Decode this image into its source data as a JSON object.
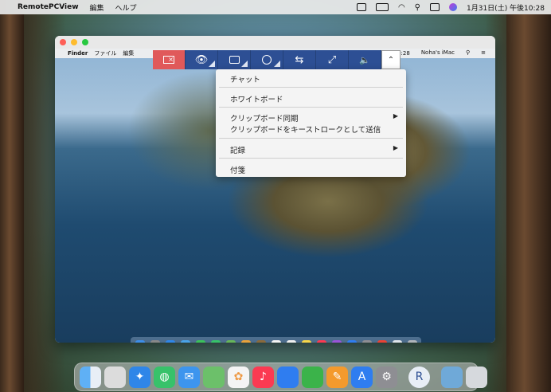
{
  "menubar": {
    "app_name": "RemotePCView",
    "items": [
      "編集",
      "ヘルプ"
    ],
    "datetime": "1月31日(土) 午後10:28"
  },
  "remote": {
    "menubar": {
      "finder": "Finder",
      "file": "ファイル",
      "edit": "編集",
      "time": "後10:28",
      "computer": "Noha's iMac"
    }
  },
  "toolbar": {
    "buttons": [
      {
        "icon": "screen-close-icon"
      },
      {
        "icon": "eye-icon"
      },
      {
        "icon": "toolbox-icon"
      },
      {
        "icon": "settings-dial-icon"
      },
      {
        "icon": "transfer-arrows-icon"
      },
      {
        "icon": "fullscreen-icon"
      },
      {
        "icon": "speaker-icon"
      },
      {
        "icon": "chevron-up-icon"
      }
    ]
  },
  "dropdown": {
    "chat": "チャット",
    "whiteboard": "ホワイトボード",
    "clipboard_sync": "クリップボード同期",
    "clipboard_keystroke": "クリップボードをキーストロークとして送信",
    "record": "記録",
    "sticky": "付箋"
  },
  "colors": {
    "toolbar_blue": "#2d4f94",
    "toolbar_red": "#e0595a"
  }
}
